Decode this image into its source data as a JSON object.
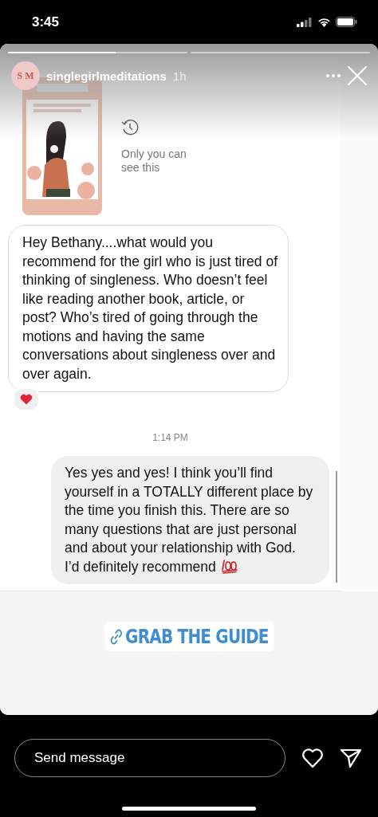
{
  "status_bar": {
    "time": "3:45"
  },
  "story": {
    "progress": {
      "level": 0.6
    },
    "account": {
      "avatar": "S M",
      "username": "singlegirlmeditations",
      "age": "1h"
    },
    "shared_post": {
      "kind": "picture",
      "note": "Only you can see this"
    },
    "messages": [
      {
        "kind": "received",
        "text": "Hey Bethany....what would you recommend for the girl who is just tired of thinking of singleness. Who doesn’t feel like reading another book, article, or post? Who’s tired of going through the motions and having the same conversations about singleness over and over again.",
        "reacted": true
      },
      {
        "kind": "time",
        "text": "1:14 PM"
      },
      {
        "kind": "sent",
        "text": "Yes yes and yes! I think you’ll find yourself in a TOTALLY different place by the time you finish this. There are so many questions that are just personal and about your relationship with God. I’d definitely recommend",
        "reacted": false
      }
    ],
    "link_sticker": "GRAB THE GUIDE"
  },
  "reply_bar": {
    "placeholder": "Send message"
  }
}
